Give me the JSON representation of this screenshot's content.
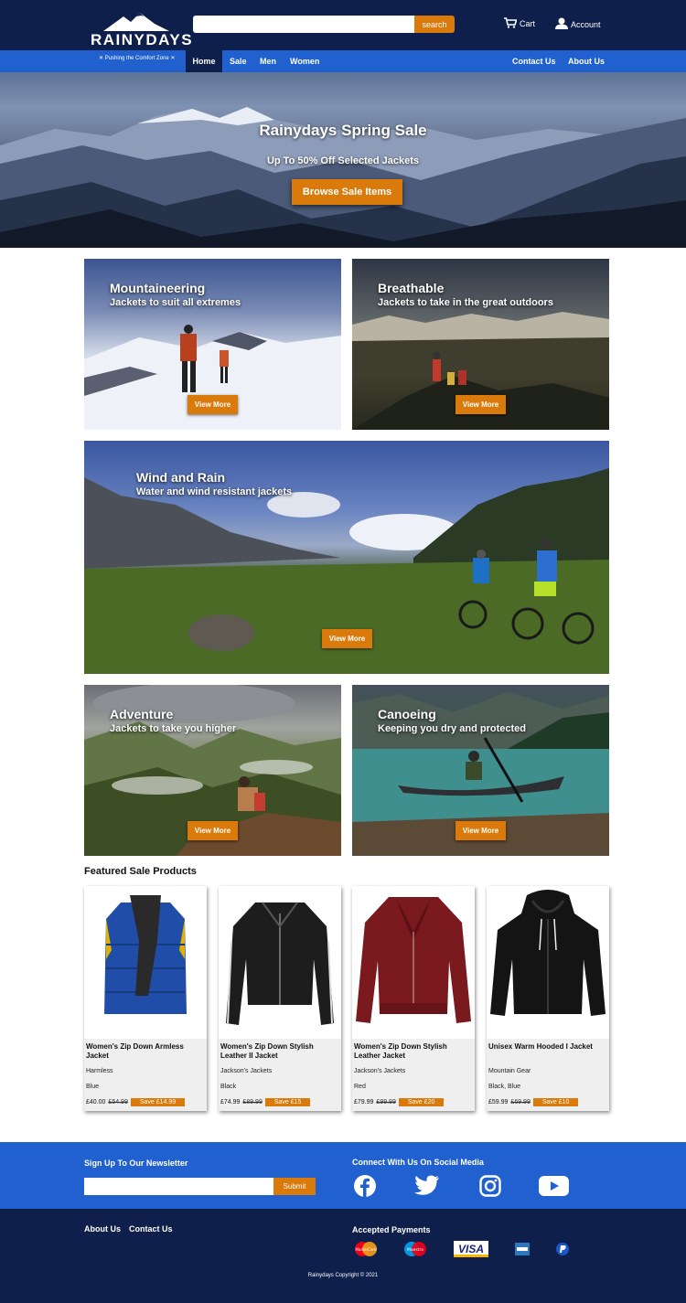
{
  "header": {
    "logo_text": "RAINYDAYS",
    "tagline": "✕ Pushing the Comfort Zone ✕",
    "search_placeholder": "",
    "search_button": "search",
    "cart_label": "Cart",
    "account_label": "Account"
  },
  "nav": {
    "left": [
      "Home",
      "Sale",
      "Men",
      "Women"
    ],
    "right": [
      "Contact Us",
      "About Us"
    ],
    "active": "Home"
  },
  "hero": {
    "title": "Rainydays Spring Sale",
    "subtitle": "Up To 50% Off Selected Jackets",
    "button": "Browse Sale Items"
  },
  "categories": [
    {
      "title": "Mountaineering",
      "subtitle": "Jackets to suit all extremes",
      "button": "View More"
    },
    {
      "title": "Breathable",
      "subtitle": "Jackets to take in the great outdoors",
      "button": "View More"
    },
    {
      "title": "Wind and Rain",
      "subtitle": "Water and wind resistant jackets",
      "button": "View More"
    },
    {
      "title": "Adventure",
      "subtitle": "Jackets to take you higher",
      "button": "View More"
    },
    {
      "title": "Canoeing",
      "subtitle": "Keeping you dry and protected",
      "button": "View More"
    }
  ],
  "featured": {
    "title": "Featured Sale Products",
    "products": [
      {
        "name": "Women's Zip Down Armless Jacket",
        "brand": "Harmless",
        "color": "Blue",
        "price": "£40.00",
        "old_price": "£54.99",
        "save": "Save £14.99"
      },
      {
        "name": "Women's Zip Down Stylish Leather II Jacket",
        "brand": "Jackson's Jackets",
        "color": "Black",
        "price": "£74.99",
        "old_price": "£89.99",
        "save": "Save £15"
      },
      {
        "name": "Women's Zip Down Stylish Leather Jacket",
        "brand": "Jackson's Jackets",
        "color": "Red",
        "price": "£79.99",
        "old_price": "£99.99",
        "save": "Save £20"
      },
      {
        "name": "Unisex Warm Hooded I Jacket",
        "brand": "Mountain Gear",
        "color": "Black, Blue",
        "price": "£59.99",
        "old_price": "£69.99",
        "save": "Save £10"
      }
    ]
  },
  "newsletter": {
    "title": "Sign Up To Our Newsletter",
    "input_value": "",
    "button": "Submit"
  },
  "social": {
    "title": "Connect With Us On Social Media",
    "icons": [
      "facebook-icon",
      "twitter-icon",
      "instagram-icon",
      "youtube-icon"
    ]
  },
  "footer": {
    "links": [
      "About Us",
      "Contact Us"
    ],
    "payments_title": "Accepted Payments",
    "payments": {
      "mastercard": "MasterCard",
      "maestro": "Maestro",
      "visa": "VISA"
    },
    "copyright": "Rainydays Copyright © 2021"
  },
  "colors": {
    "navy": "#0d1f4a",
    "blue": "#2060cf",
    "orange": "#d97a0b"
  }
}
